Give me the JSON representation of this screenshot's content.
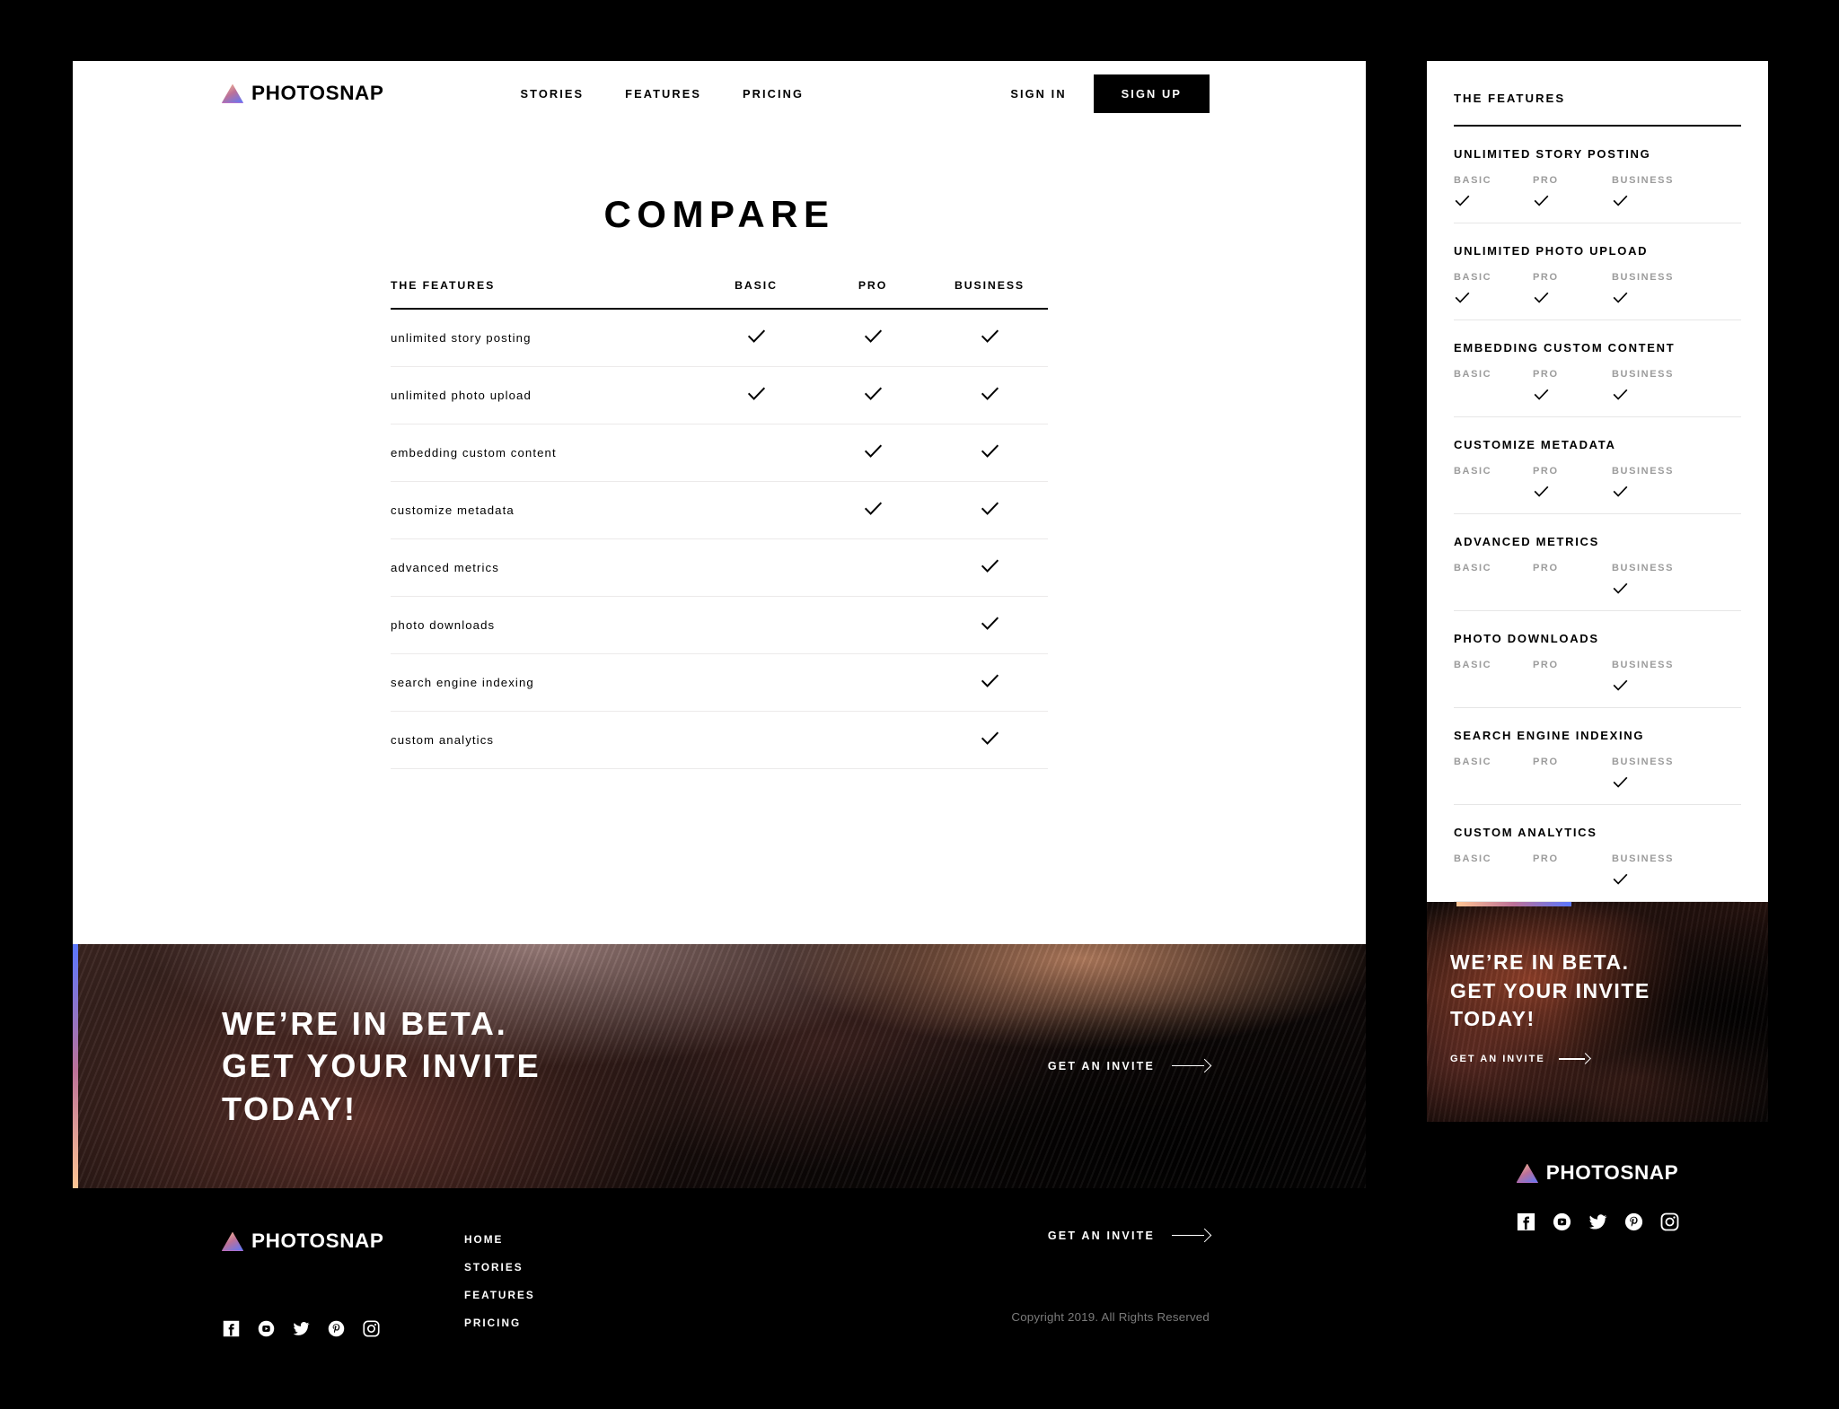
{
  "brand": {
    "name": "PHOTOSNAP",
    "logo_icon": "triangle-logo-icon",
    "gradient": [
      "#ffc593",
      "#bc7198",
      "#5a77ff"
    ]
  },
  "header": {
    "nav": [
      {
        "label": "STORIES"
      },
      {
        "label": "FEATURES"
      },
      {
        "label": "PRICING"
      }
    ],
    "sign_in": "SIGN IN",
    "sign_up": "SIGN UP"
  },
  "page_title": "COMPARE",
  "compare_table": {
    "columns": [
      "THE FEATURES",
      "BASIC",
      "PRO",
      "BUSINESS"
    ],
    "rows": [
      {
        "feature": "unlimited story posting",
        "mobile_label": "UNLIMITED STORY POSTING",
        "basic": true,
        "pro": true,
        "business": true
      },
      {
        "feature": "unlimited photo upload",
        "mobile_label": "UNLIMITED PHOTO UPLOAD",
        "basic": true,
        "pro": true,
        "business": true
      },
      {
        "feature": "embedding custom content",
        "mobile_label": "EMBEDDING CUSTOM CONTENT",
        "basic": false,
        "pro": true,
        "business": true
      },
      {
        "feature": "customize metadata",
        "mobile_label": "CUSTOMIZE METADATA",
        "basic": false,
        "pro": true,
        "business": true
      },
      {
        "feature": "advanced metrics",
        "mobile_label": "ADVANCED METRICS",
        "basic": false,
        "pro": false,
        "business": true
      },
      {
        "feature": "photo downloads",
        "mobile_label": "PHOTO DOWNLOADS",
        "basic": false,
        "pro": false,
        "business": true
      },
      {
        "feature": "search engine indexing",
        "mobile_label": "SEARCH ENGINE INDEXING",
        "basic": false,
        "pro": false,
        "business": true
      },
      {
        "feature": "custom analytics",
        "mobile_label": "CUSTOM ANALYTICS",
        "basic": false,
        "pro": false,
        "business": true
      }
    ]
  },
  "beta": {
    "heading_line1": "WE’RE IN BETA.",
    "heading_line2": "GET YOUR INVITE",
    "heading_line3": "TODAY!",
    "cta": "GET AN INVITE"
  },
  "footer": {
    "cta": "GET AN INVITE",
    "links": [
      {
        "label": "HOME"
      },
      {
        "label": "STORIES"
      },
      {
        "label": "FEATURES"
      },
      {
        "label": "PRICING"
      }
    ],
    "copyright": "Copyright 2019. All Rights Reserved",
    "social": [
      {
        "name": "facebook-icon"
      },
      {
        "name": "youtube-icon"
      },
      {
        "name": "twitter-icon"
      },
      {
        "name": "pinterest-icon"
      },
      {
        "name": "instagram-icon"
      }
    ]
  }
}
